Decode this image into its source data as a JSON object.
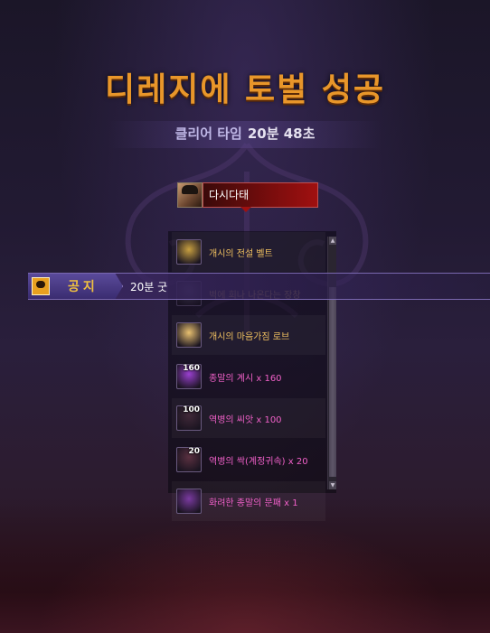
{
  "title": "디레지에 토벌 성공",
  "clear_time": {
    "label": "클리어 타임",
    "value": "20분 48초"
  },
  "player": {
    "name": "다시다태"
  },
  "notice": {
    "badge": "공지",
    "message": "20분 굿"
  },
  "rewards": [
    {
      "label": "개시의 전설 벨트",
      "count": "",
      "rarity": "epic",
      "icon": "belt-icon",
      "icon_color": "#c8a040"
    },
    {
      "label": "벽에 회나 나온다는 장창",
      "count": "",
      "rarity": "epic",
      "icon": "spear-icon",
      "icon_color": "#5a5070"
    },
    {
      "label": "개시의 마음가짐 로브",
      "count": "",
      "rarity": "epic",
      "icon": "robe-icon",
      "icon_color": "#e8c070"
    },
    {
      "label": "종말의 계시 x 160",
      "count": "160",
      "rarity": "unique",
      "icon": "orb-icon",
      "icon_color": "#9a40d0"
    },
    {
      "label": "역병의 씨앗 x 100",
      "count": "100",
      "rarity": "unique",
      "icon": "seed-icon",
      "icon_color": "#402838"
    },
    {
      "label": "역병의 싹(계정귀속) x 20",
      "count": "20",
      "rarity": "unique",
      "icon": "sprout-icon",
      "icon_color": "#5a3040"
    },
    {
      "label": "화려한 종말의 문패 x 1",
      "count": "",
      "rarity": "unique",
      "icon": "rose-icon",
      "icon_color": "#7a3aa0"
    }
  ]
}
